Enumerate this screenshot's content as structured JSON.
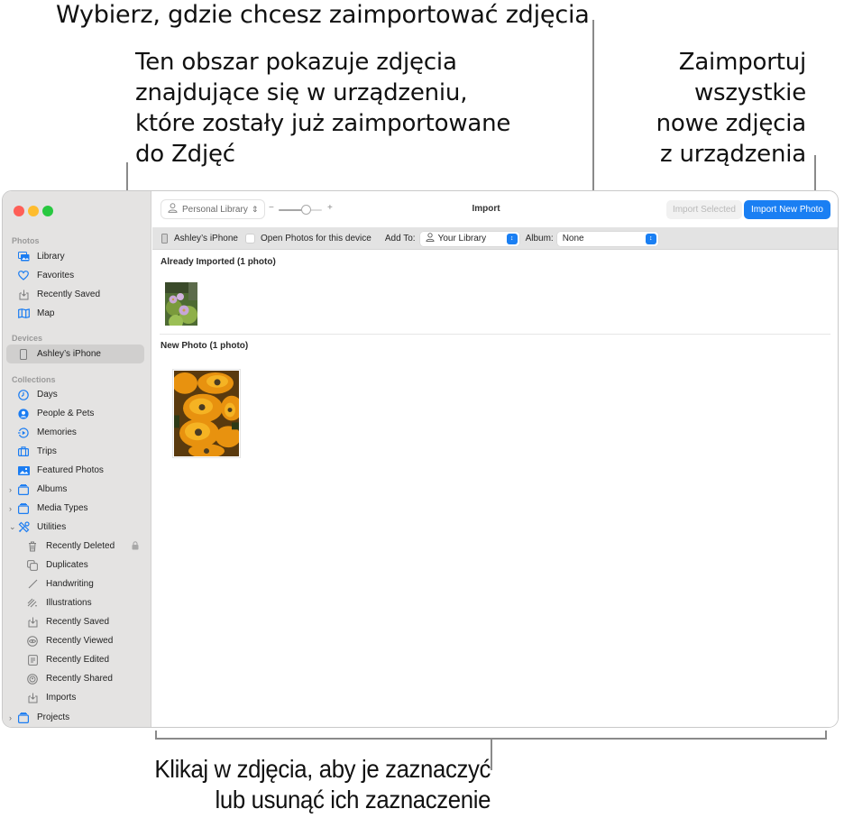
{
  "callouts": {
    "top": "Wybierz, gdzie chcesz zaimportować zdjęcia",
    "left": "Ten obszar pokazuje zdjęcia\nznajdujące się w urządzeniu,\nktóre zostały już zaimportowane\ndo Zdjęć",
    "right": "Zaimportuj\nwszystkie\nnowe zdjęcia\nz urządzenia",
    "bottom": "Klikaj w zdjęcia, aby je zaznaczyć\nlub usunąć ich zaznaczenie"
  },
  "sidebar": {
    "sections": {
      "photos": "Photos",
      "devices": "Devices",
      "collections": "Collections"
    },
    "photos_items": [
      {
        "label": "Library",
        "icon": "library-icon"
      },
      {
        "label": "Favorites",
        "icon": "heart-icon"
      },
      {
        "label": "Recently Saved",
        "icon": "tray-download-icon"
      },
      {
        "label": "Map",
        "icon": "map-icon"
      }
    ],
    "device_items": [
      {
        "label": "Ashley’s iPhone",
        "icon": "iphone-icon",
        "selected": true
      }
    ],
    "collection_items": [
      {
        "label": "Days",
        "icon": "clock-icon"
      },
      {
        "label": "People & Pets",
        "icon": "person-circle-icon"
      },
      {
        "label": "Memories",
        "icon": "memories-play-icon"
      },
      {
        "label": "Trips",
        "icon": "suitcase-icon"
      },
      {
        "label": "Featured Photos",
        "icon": "photo-icon"
      },
      {
        "label": "Albums",
        "icon": "folder-stack-icon",
        "expandable": true,
        "expanded": false
      },
      {
        "label": "Media Types",
        "icon": "folder-stack-icon",
        "expandable": true,
        "expanded": false
      },
      {
        "label": "Utilities",
        "icon": "tools-icon",
        "expandable": true,
        "expanded": true
      }
    ],
    "utility_items": [
      {
        "label": "Recently Deleted",
        "icon": "trash-icon",
        "locked": true
      },
      {
        "label": "Duplicates",
        "icon": "duplicate-icon"
      },
      {
        "label": "Handwriting",
        "icon": "pen-line-icon"
      },
      {
        "label": "Illustrations",
        "icon": "illustration-icon"
      },
      {
        "label": "Recently Saved",
        "icon": "tray-download-icon"
      },
      {
        "label": "Recently Viewed",
        "icon": "eye-icon"
      },
      {
        "label": "Recently Edited",
        "icon": "edit-doc-icon"
      },
      {
        "label": "Recently Shared",
        "icon": "shared-icon"
      },
      {
        "label": "Imports",
        "icon": "tray-download-icon"
      }
    ],
    "bottom_items": [
      {
        "label": "Projects",
        "icon": "folder-stack-icon",
        "expandable": true,
        "expanded": false
      }
    ]
  },
  "toolbar": {
    "library_selector": "Personal Library",
    "zoom_minus": "−",
    "zoom_plus": "+",
    "zoom_level": 0.62,
    "title": "Import",
    "import_selected": "Import Selected",
    "import_new": "Import New Photo"
  },
  "device_bar": {
    "device_name": "Ashley’s iPhone",
    "open_photos_label": "Open Photos for this device",
    "open_photos_checked": false,
    "add_to_label": "Add To:",
    "add_to_value": "Your Library",
    "album_label": "Album:",
    "album_value": "None"
  },
  "content": {
    "already_imported_title": "Already Imported (1 photo)",
    "new_photo_title": "New Photo (1 photo)"
  },
  "colors": {
    "accent": "#1a7ff3",
    "sidebar_bg": "#e4e3e2",
    "traffic_red": "#fe5f57",
    "traffic_yellow": "#febc2e",
    "traffic_green": "#28c840"
  }
}
